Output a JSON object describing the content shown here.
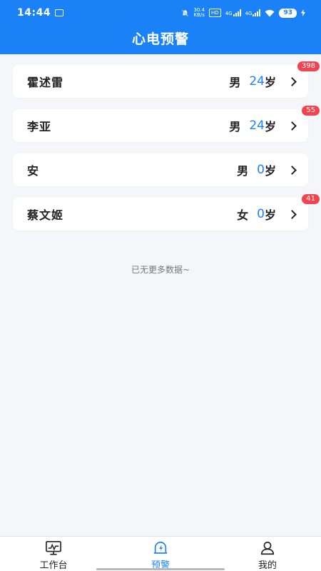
{
  "status": {
    "time": "14:44",
    "speed_value": "30.4",
    "speed_unit": "KB/s",
    "hd": "HD",
    "sig1": "4G",
    "sig2": "4G",
    "battery": "93"
  },
  "header": {
    "title": "心电预警"
  },
  "list": {
    "items": [
      {
        "name": "霍述雷",
        "gender": "男",
        "age": "24",
        "unit": "岁",
        "badge": "398"
      },
      {
        "name": "李亚",
        "gender": "男",
        "age": "24",
        "unit": "岁",
        "badge": "55"
      },
      {
        "name": "安",
        "gender": "男",
        "age": "0",
        "unit": "岁",
        "badge": ""
      },
      {
        "name": "蔡文姬",
        "gender": "女",
        "age": "0",
        "unit": "岁",
        "badge": "41"
      }
    ],
    "end_text": "已无更多数据~"
  },
  "tabbar": {
    "tabs": [
      {
        "label": "工作台",
        "icon": "monitor-icon"
      },
      {
        "label": "预警",
        "icon": "alarm-bell-icon"
      },
      {
        "label": "我的",
        "icon": "user-icon"
      }
    ],
    "active_color": "#1a82f6"
  },
  "colors": {
    "brand": "#1a82f6",
    "badge": "#f2444e",
    "background": "#f4f6fa"
  }
}
